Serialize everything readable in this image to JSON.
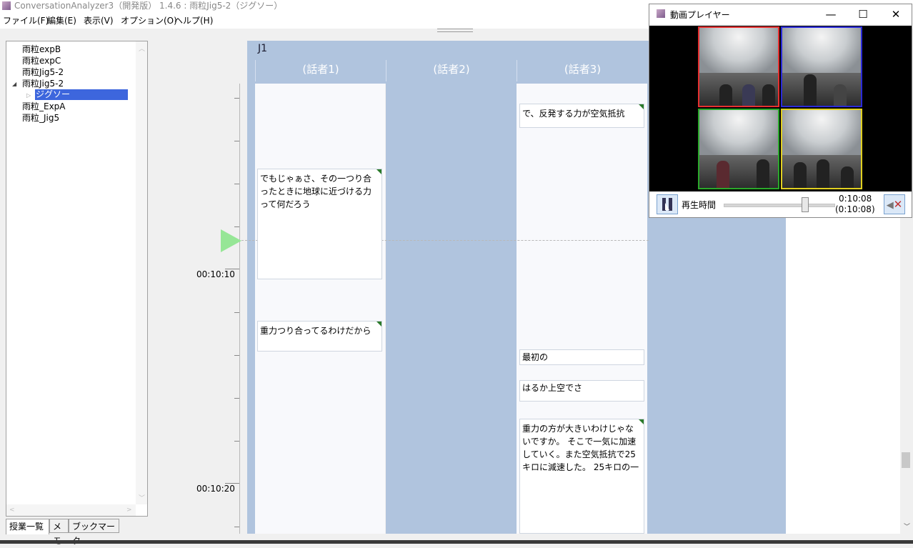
{
  "app": {
    "title": "ConversationAnalyzer3（開発版） 1.4.6 : 雨粒Jig5-2（ジグソー）"
  },
  "menu": [
    "ファイル(F)",
    "編集(E)",
    "表示(V)",
    "オプション(O)",
    "ヘルプ(H)"
  ],
  "tree": {
    "items": [
      "雨粒expB",
      "雨粒expC",
      "雨粒Jig5-2",
      "雨粒Jig5-2",
      "ジグソー",
      "雨粒_ExpA",
      "雨粒_Jig5"
    ],
    "selected_index": 4
  },
  "bottom_tabs": [
    "授業一覧",
    "メモ",
    "ブックマーク"
  ],
  "timeline": {
    "time_labels": [
      "00:10:10",
      "00:10:20"
    ],
    "group": "J1",
    "speakers": [
      "(話者1)",
      "(話者2)",
      "(話者3)"
    ],
    "utterances": {
      "s1_a": "でもじゃぁさ、その一つり合ったときに地球に近づける力って何だろう",
      "s1_b": "重力つり合ってるわけだから",
      "s3_a": "で、反発する力が空気抵抗",
      "s3_b": "最初の",
      "s3_c": "はるか上空でさ",
      "s3_d": "重力の方が大きいわけじゃないですか。 そこで一気に加速していく。また空気抵抗で25キロに減速した。 25キロの一"
    }
  },
  "player": {
    "title": "動画プレイヤー",
    "time_caption": "再生時間",
    "current": "0:10:08",
    "total": "(0:10:08)",
    "slider_fraction": 0.73,
    "camera_colors": [
      "#e53030",
      "#2a2ad8",
      "#2aa82a",
      "#e0d020"
    ],
    "win_minimize": "—",
    "win_maximize": "☐",
    "win_close": "✕",
    "mute_icon": "✕"
  }
}
